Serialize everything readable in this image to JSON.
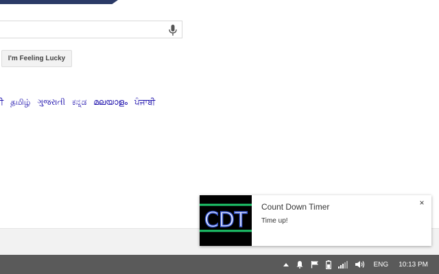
{
  "search": {
    "value": ""
  },
  "buttons": {
    "lucky_label": "I'm Feeling Lucky"
  },
  "languages": [
    "ਰੀ",
    "தமிழ்",
    "ગુજરાતી",
    "ಕನ್ನಡ",
    "മലയാളം",
    "ਪੰਜਾਬੀ"
  ],
  "notification": {
    "logo_text": "CDT",
    "title": "Count Down Timer",
    "message": "Time up!",
    "close_glyph": "×"
  },
  "taskbar": {
    "language": "ENG",
    "time": "10:13 PM"
  },
  "colors": {
    "banner": "#2b3a67",
    "link": "#1a0dab",
    "taskbar": "#5a5a5a",
    "logo_green": "#1ec86b",
    "logo_blue": "#3b5bd6"
  },
  "icons": [
    "mic-icon",
    "chevron-up-icon",
    "notification-bell-icon",
    "flag-icon",
    "battery-icon",
    "network-signal-icon",
    "speaker-icon",
    "close-icon"
  ]
}
